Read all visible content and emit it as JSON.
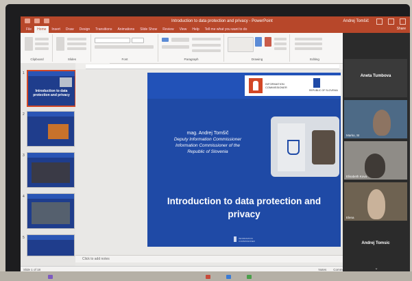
{
  "window": {
    "title": "Introduction to data protection and privacy - PowerPoint",
    "account": "Andrej Tomšič",
    "tabs": [
      "File",
      "Home",
      "Insert",
      "Draw",
      "Design",
      "Transitions",
      "Animations",
      "Slide Show",
      "Review",
      "View",
      "Help",
      "Tell me what you want to do"
    ],
    "active_tab": "Home",
    "share_label": "Share"
  },
  "ribbon": {
    "groups": [
      "Clipboard",
      "Slides",
      "Font",
      "Paragraph",
      "Drawing",
      "Editing"
    ]
  },
  "thumbnails": {
    "numbers": [
      "1",
      "2",
      "3",
      "4",
      "5"
    ],
    "first_title": "Introduction to data protection and privacy"
  },
  "slide": {
    "logo_text": "INFORMATION COMMISSIONER",
    "logo2_text": "REPUBLIC OF SLOVENIA",
    "speaker_name": "mag. Andrej Tomšič",
    "speaker_role1": "Deputy Information Commissioner",
    "speaker_role2": "Information Commissioner of the",
    "speaker_role3": "Republic of Slovenia",
    "title": "Introduction to data protection and privacy",
    "footer_text": "INFORMATION COMMISSIONER"
  },
  "notes_placeholder": "Click to add notes",
  "status": {
    "left": "Slide 1 of 18",
    "notes_label": "Notes",
    "comments_label": "Comments"
  },
  "participants": [
    {
      "name": "Aneta Tumbova"
    },
    {
      "name": "Marko, SI"
    },
    {
      "name": "Elisabeth Kova"
    },
    {
      "name": "Elena"
    },
    {
      "name": "Andrej Tomsic"
    }
  ],
  "colors": {
    "accent": "#b7472a",
    "slide_blue": "#1f4aa6"
  }
}
